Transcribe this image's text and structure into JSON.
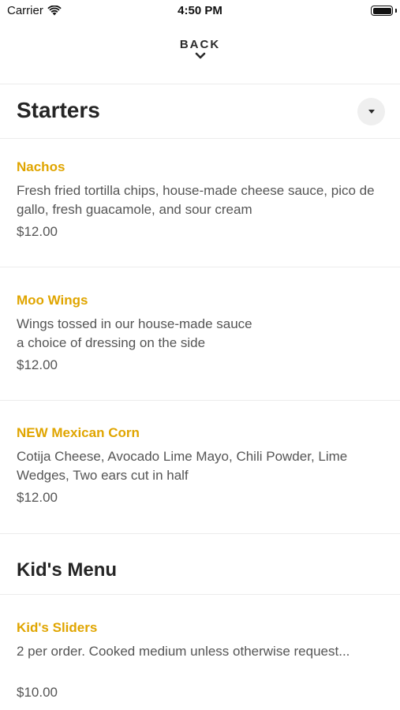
{
  "status_bar": {
    "carrier": "Carrier",
    "time": "4:50 PM",
    "icons": [
      "wifi-icon",
      "battery-icon"
    ]
  },
  "nav": {
    "back_label": "BACK",
    "back_icon": "chevron-down-icon"
  },
  "sections": [
    {
      "title": "Starters",
      "toggle_icon": "caret-down-icon",
      "items": [
        {
          "name": "Nachos",
          "description": "Fresh fried tortilla chips, house-made cheese sauce, pico de gallo, fresh guacamole, and sour cream",
          "price": "$12.00"
        },
        {
          "name": "Moo Wings",
          "description": "Wings tossed in our house-made sauce\na choice of dressing on the side",
          "price": "$12.00"
        },
        {
          "name": "NEW Mexican Corn",
          "description": "Cotija Cheese, Avocado Lime Mayo, Chili Powder, Lime Wedges, Two ears cut in half",
          "price": "$12.00"
        }
      ]
    },
    {
      "title": "Kid's Menu",
      "items": [
        {
          "name": "Kid's Sliders",
          "description": "2 per order. Cooked medium unless otherwise request...",
          "price": "$10.00"
        }
      ]
    }
  ],
  "colors": {
    "item_name": "#e0a500",
    "body_text": "#555555",
    "divider": "#ececec"
  }
}
